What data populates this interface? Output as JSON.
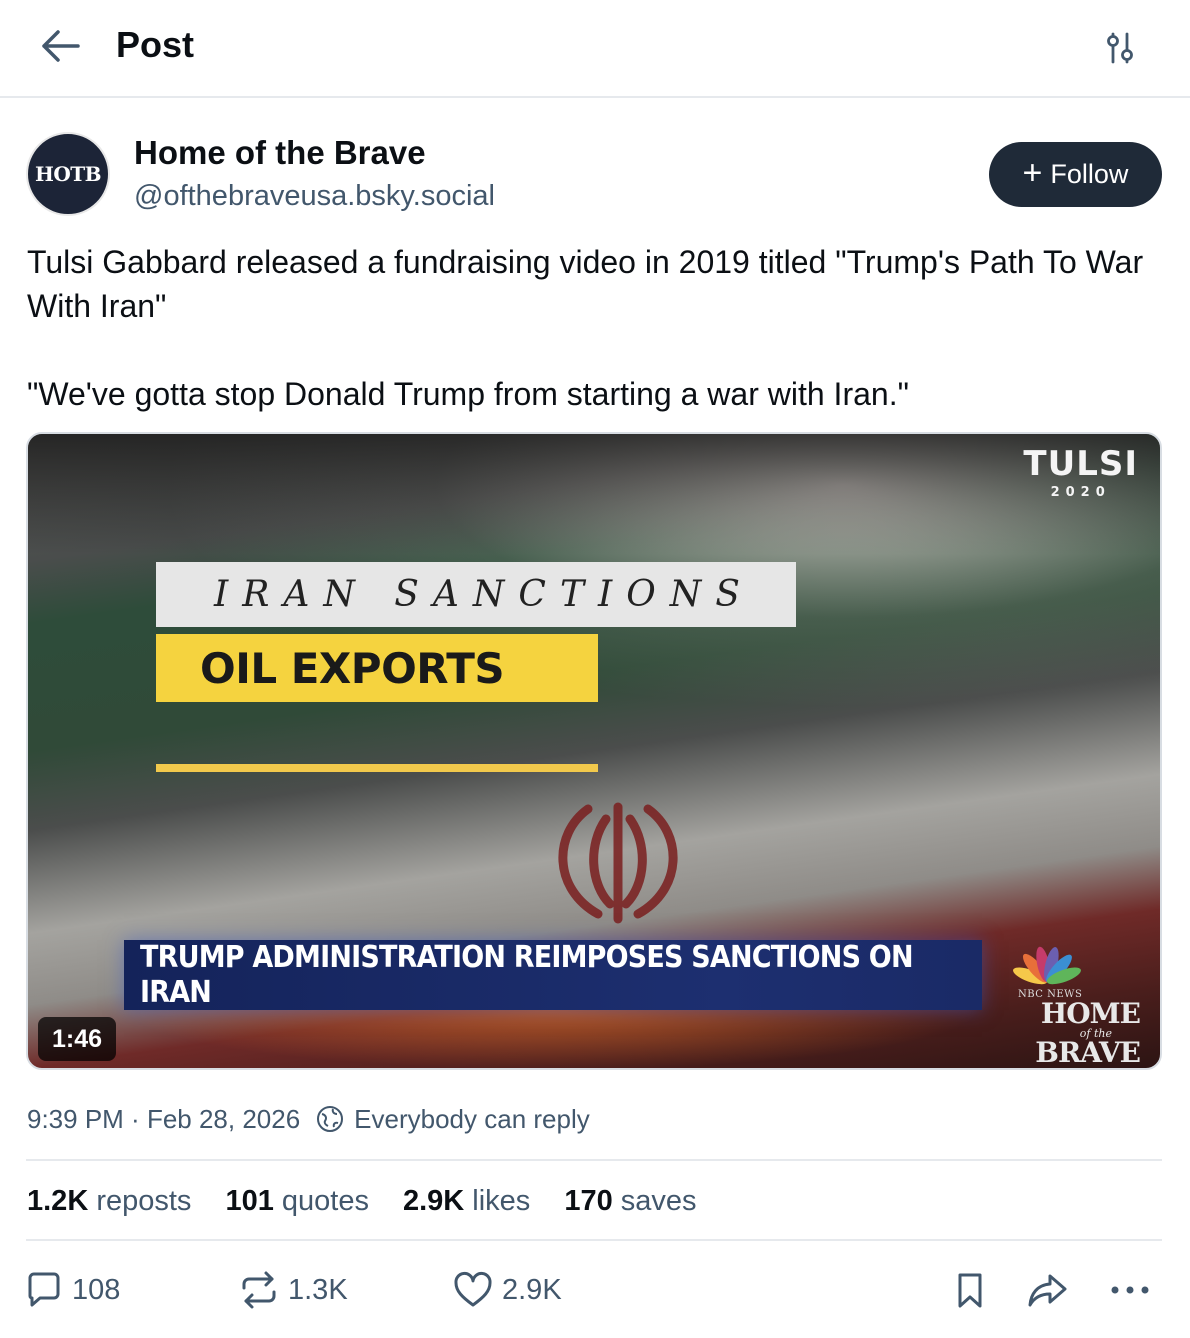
{
  "header": {
    "title": "Post"
  },
  "author": {
    "avatar_text": "HOTB",
    "name": "Home of the Brave",
    "handle": "@ofthebraveusa.bsky.social",
    "follow_label": "Follow"
  },
  "post": {
    "paragraphs": [
      "Tulsi Gabbard released a fundraising video in 2019 titled \"Trump's Path To War With Iran\"",
      "\"We've gotta stop Donald Trump from starting a war with Iran.\""
    ]
  },
  "video": {
    "headline_top": "IRAN SANCTIONS",
    "headline_sub": "OIL EXPORTS",
    "lower_third": "TRUMP ADMINISTRATION REIMPOSES SANCTIONS ON IRAN",
    "brand_name": "TULSI",
    "brand_year": "2020",
    "watermark_network": "NBC NEWS",
    "watermark_line1": "HOME",
    "watermark_line2": "of the",
    "watermark_line3": "BRAVE",
    "duration": "1:46"
  },
  "meta": {
    "time": "9:39 PM",
    "separator": " · ",
    "date": "Feb 28, 2026",
    "reply_setting": "Everybody can reply"
  },
  "stats": {
    "reposts_count": "1.2K",
    "reposts_label": "reposts",
    "quotes_count": "101",
    "quotes_label": "quotes",
    "likes_count": "2.9K",
    "likes_label": "likes",
    "saves_count": "170",
    "saves_label": "saves"
  },
  "actions": {
    "replies": "108",
    "reposts": "1.3K",
    "likes": "2.9K"
  },
  "icons": {
    "back": "arrow-left-icon",
    "filter": "sliders-icon",
    "reply": "speech-bubble-icon",
    "repost": "repost-arrows-icon",
    "like": "heart-icon",
    "bookmark": "bookmark-icon",
    "share": "share-arrow-icon",
    "more": "ellipsis-icon",
    "globe": "globe-icon"
  },
  "colors": {
    "follow_bg": "#1f2a38",
    "muted_text": "#42576c",
    "divider": "#e6e9ed",
    "headline_yellow": "#f5d33f",
    "lower_third_blue": "#1d2f70"
  }
}
